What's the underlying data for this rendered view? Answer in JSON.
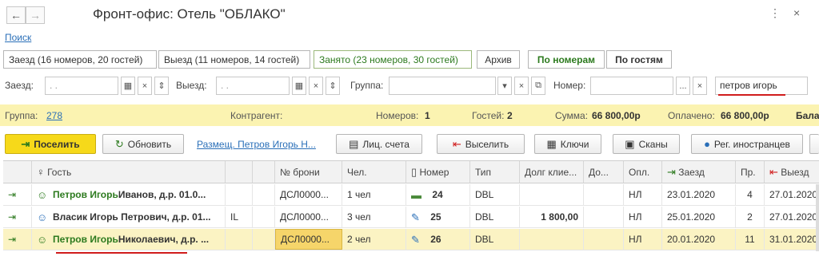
{
  "window": {
    "title": "Фронт-офис: Отель \"ОБЛАКО\"",
    "back": "←",
    "forward": "→",
    "more": "⋮",
    "close": "×"
  },
  "search_link": "Поиск",
  "filters": [
    "Заезд (16 номеров, 20 гостей)",
    "Выезд (11 номеров, 14 гостей)",
    "Занято (23 номеров, 30 гостей)",
    "Архив"
  ],
  "view_tabs": [
    "По номерам",
    "По гостям"
  ],
  "search_bar": {
    "checkin_label": "Заезд:",
    "checkin_value": " .  .",
    "checkout_label": "Выезд:",
    "checkout_value": " .  .",
    "group_label": "Группа:",
    "group_value": "",
    "room_label": "Номер:",
    "room_value": "",
    "search_value": "петров игорь",
    "dots": "...",
    "clear": "×"
  },
  "info": {
    "group_label": "Группа:",
    "group_value": "278",
    "contractor_label": "Контрагент:",
    "rooms_label": "Номеров:",
    "rooms_value": "1",
    "guests_label": "Гостей:",
    "guests_value": "2",
    "sum_label": "Сумма:",
    "sum_value": "66 800,00р",
    "paid_label": "Оплачено:",
    "paid_value": "66 800,00р",
    "balance_label": "Бала"
  },
  "toolbar": {
    "checkin": "Поселить",
    "refresh": "Обновить",
    "placement": "Размещ. Петров Игорь Н...",
    "accounts": "Лиц. счета",
    "checkout": "Выселить",
    "keys": "Ключи",
    "scans": "Сканы",
    "foreigners": "Рег. иностранцев"
  },
  "table": {
    "headers": {
      "guest": "Гость",
      "booking": "№ брони",
      "people": "Чел.",
      "room": "Номер",
      "type": "Тип",
      "debt": "Долг клие...",
      "extra": "До...",
      "pay": "Опл.",
      "arrival": "Заезд",
      "nights": "Пр.",
      "departure": "Выезд"
    },
    "rows": [
      {
        "guest_green": "Петров Игорь",
        "guest_rest": " Иванов, д.р. 01.0...",
        "mark": "",
        "booking": "ДСЛ0000...",
        "people": "1 чел",
        "room": "24",
        "type": "DBL",
        "debt": "",
        "pay": "НЛ",
        "arrival": "23.01.2020",
        "nights": "4",
        "departure": "27.01.2020"
      },
      {
        "guest_green": "Власик Игорь Петрович",
        "guest_rest": ", д.р. 01...",
        "mark": "IL",
        "booking": "ДСЛ0000...",
        "people": "3 чел",
        "room": "25",
        "type": "DBL",
        "debt": "1 800,00",
        "pay": "НЛ",
        "arrival": "25.01.2020",
        "nights": "2",
        "departure": "27.01.2020"
      },
      {
        "guest_green": "Петров Игорь",
        "guest_rest": " Николаевич, д.р. ...",
        "mark": "",
        "booking": "ДСЛ0000...",
        "people": "2 чел",
        "room": "26",
        "type": "DBL",
        "debt": "",
        "pay": "НЛ",
        "arrival": "20.01.2020",
        "nights": "11",
        "departure": "31.01.2020"
      }
    ]
  },
  "colors": {
    "accent_green": "#2c7a1e",
    "highlight_yellow": "#fbf3b1",
    "link_blue": "#2a6fb8",
    "underline_red": "#d01c1c"
  }
}
